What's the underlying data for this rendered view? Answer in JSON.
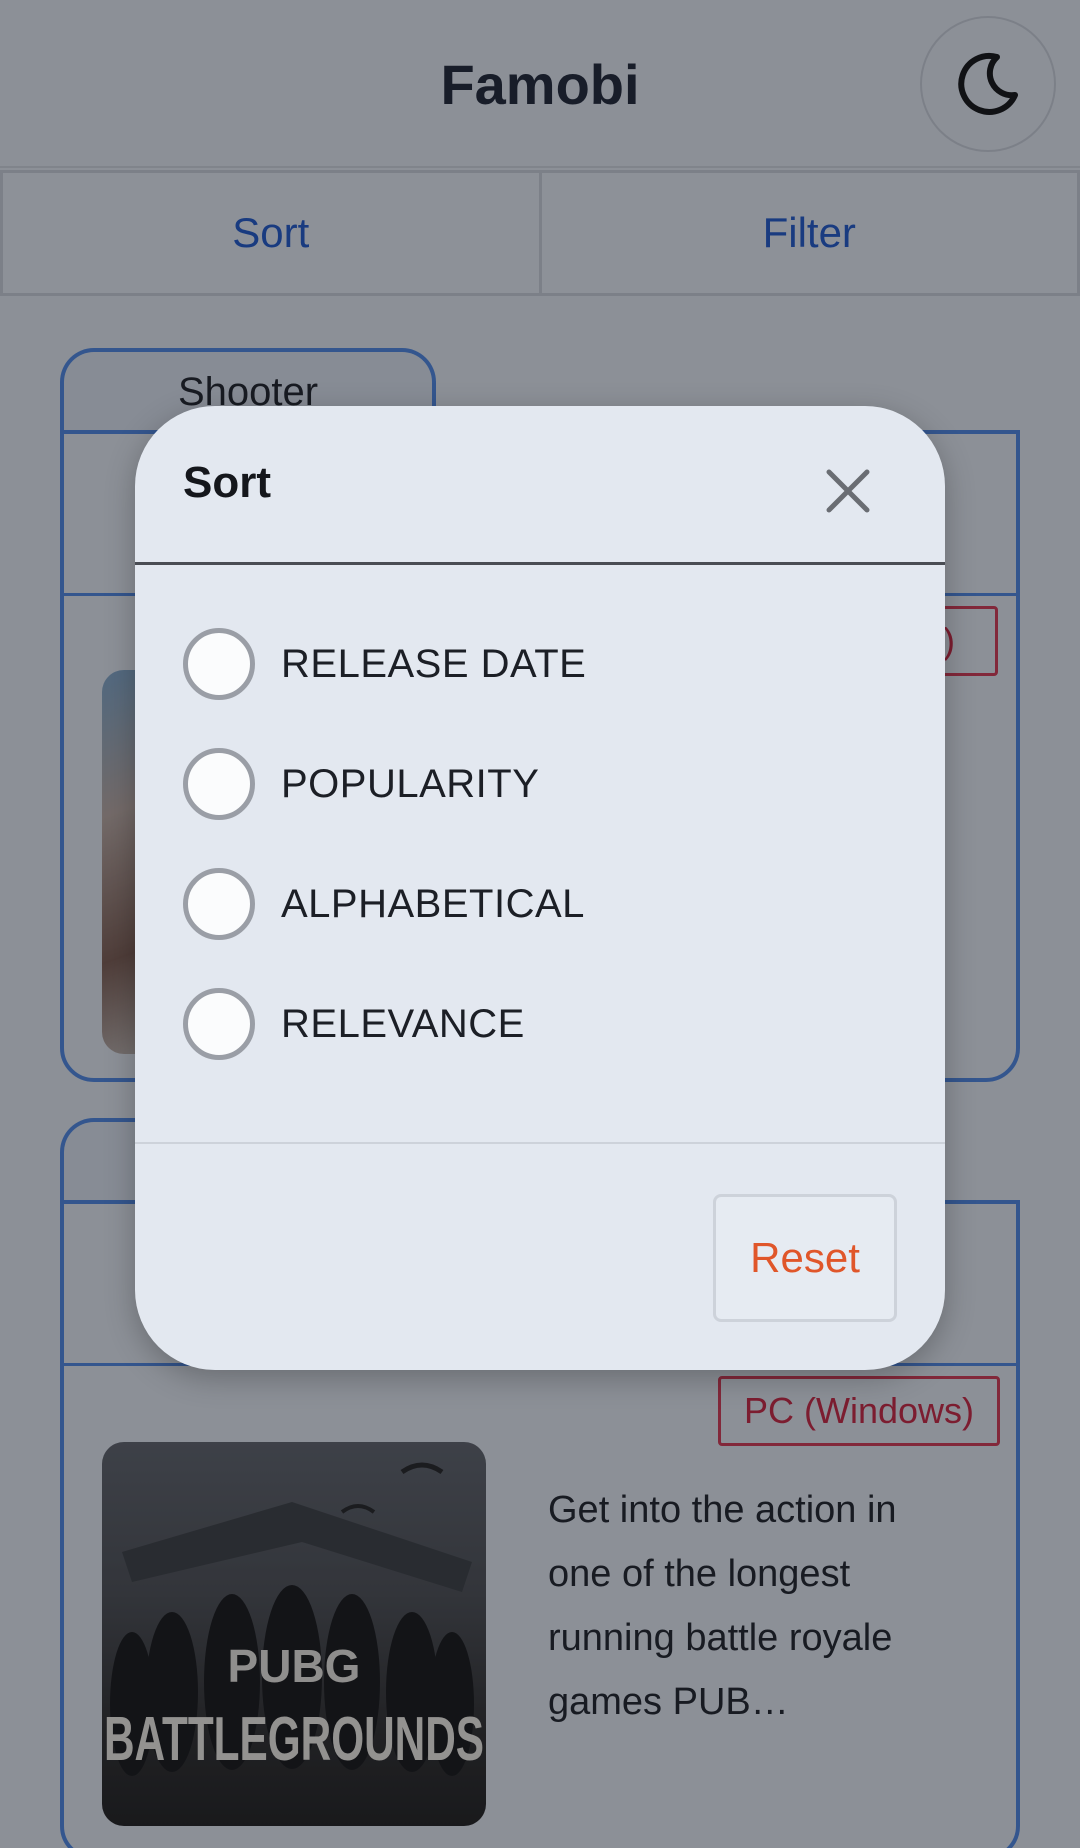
{
  "header": {
    "title": "Famobi",
    "theme_icon": "moon-icon"
  },
  "tabs": [
    {
      "label": "Sort"
    },
    {
      "label": "Filter"
    }
  ],
  "cards": [
    {
      "genre": "Shooter",
      "platform": "(Windows)",
      "platform_visible": "s)"
    },
    {
      "genre": "",
      "platform": "PC (Windows)",
      "description": "Get into the action in one of the longest running battle royale games PUB…",
      "image_text_top": "PUBG",
      "image_text_bottom": "BATTLEGROUNDS"
    }
  ],
  "sort_dialog": {
    "title": "Sort",
    "close_icon": "close-icon",
    "options": [
      {
        "label": "RELEASE DATE",
        "selected": false
      },
      {
        "label": "POPULARITY",
        "selected": false
      },
      {
        "label": "ALPHABETICAL",
        "selected": false
      },
      {
        "label": "RELEVANCE",
        "selected": false
      }
    ],
    "reset_label": "Reset"
  },
  "colors": {
    "accent": "#1e57c9",
    "card_border": "#4d86e0",
    "platform": "#c8243f",
    "reset": "#e0562a"
  }
}
